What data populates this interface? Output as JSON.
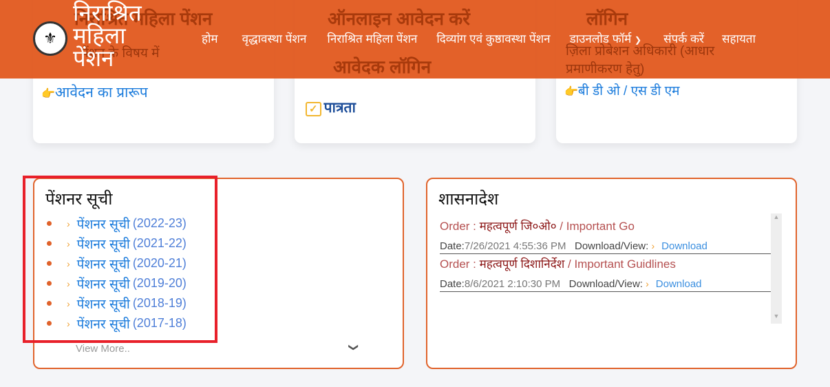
{
  "cards": [
    {
      "heading": "निराश्रित महिला पेंशन",
      "sub": "पेंशन के विषय में",
      "link": "आवेदन का प्रारूप"
    },
    {
      "heading": "ऑनलाइन आवेदन करें",
      "sub": "आवेदक लॉगिन",
      "link": "पात्रता"
    },
    {
      "heading": "लॉगिन",
      "sub": "ज़िला प्रोबेशन अधिकारी (आधार प्रमाणीकरण हेतु)",
      "link": "बी डी ओ / एस डी एम"
    }
  ],
  "header": {
    "brand": "निराश्रित महिला पेंशन",
    "nav": [
      "होम",
      "वृद्धावस्था पेंशन",
      "निराश्रित महिला पेंशन",
      "दिव्यांग एवं कुष्ठावस्था पेंशन",
      "डाउनलोड फॉर्म",
      "संपर्क करें",
      "सहायता"
    ]
  },
  "pensioner": {
    "title": "पेंशनर सूची",
    "items": [
      {
        "label": "पेंशनर सूची",
        "year": "(2022-23)"
      },
      {
        "label": "पेंशनर सूची",
        "year": "(2021-22)"
      },
      {
        "label": "पेंशनर सूची",
        "year": "(2020-21)"
      },
      {
        "label": "पेंशनर सूची",
        "year": "(2019-20)"
      },
      {
        "label": "पेंशनर सूची",
        "year": "(2018-19)"
      },
      {
        "label": "पेंशनर सूची",
        "year": "(2017-18)"
      }
    ],
    "view_more": "View More.."
  },
  "orders": {
    "title": "शासनादेश",
    "items": [
      {
        "prefix": "Order :",
        "hindi": "महत्वपूर्ण जि०ओ०",
        "english": "/ Important Go",
        "date_label": "Date:",
        "date": "7/26/2021 4:55:36 PM",
        "dl_label": "Download/View:",
        "dl": "Download"
      },
      {
        "prefix": "Order :",
        "hindi": "महत्वपूर्ण दिशानिर्देश",
        "english": "/ Important Guidlines",
        "date_label": "Date:",
        "date": "8/6/2021 2:10:30 PM",
        "dl_label": "Download/View:",
        "dl": "Download"
      }
    ]
  },
  "colors": {
    "header": "#e1581e",
    "accent": "#e0622a",
    "link": "#1a7bdc",
    "highlight": "#e8202a"
  }
}
